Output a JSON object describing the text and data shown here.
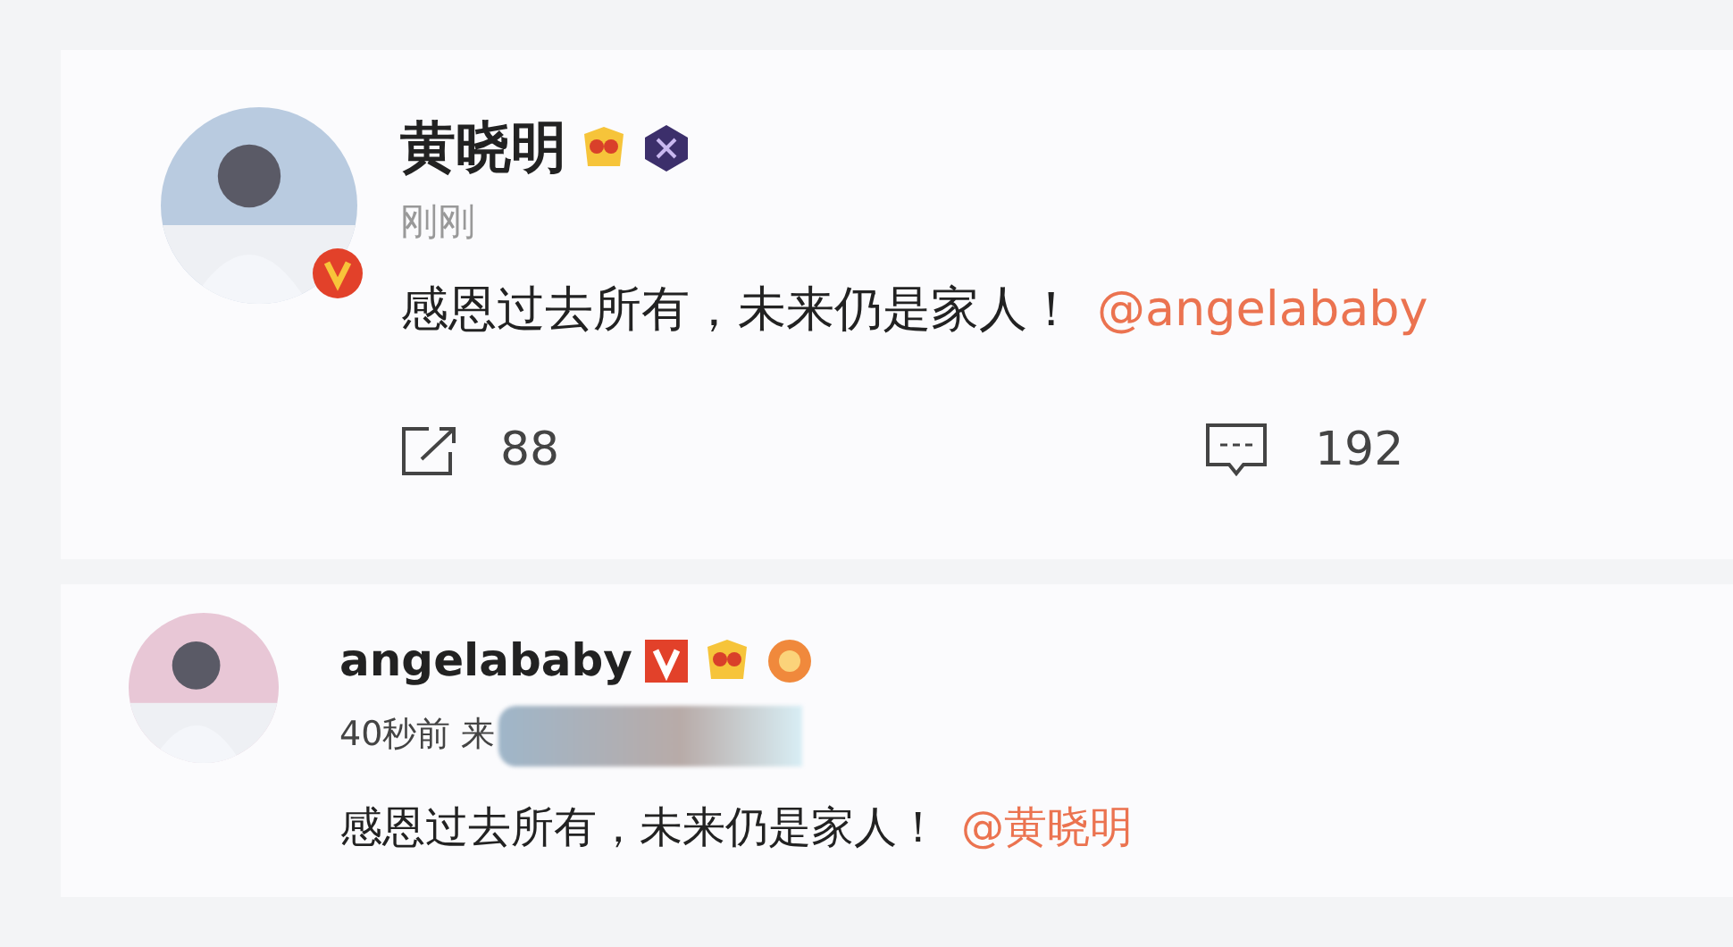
{
  "posts": [
    {
      "author": "黄晓明",
      "verified": true,
      "badges": [
        {
          "kind": "gold"
        },
        {
          "kind": "night"
        }
      ],
      "time": "刚刚",
      "text": "感恩过去所有，未来仍是家人！",
      "mention": "@angelababy",
      "reposts": "88",
      "comments": "192"
    },
    {
      "author": "angelababy",
      "verified": true,
      "badges": [
        {
          "kind": "gold"
        },
        {
          "kind": "orange"
        }
      ],
      "time": "40秒前 来",
      "redacted": true,
      "text": "感恩过去所有，未来仍是家人！",
      "mention": "@黄晓明"
    }
  ]
}
